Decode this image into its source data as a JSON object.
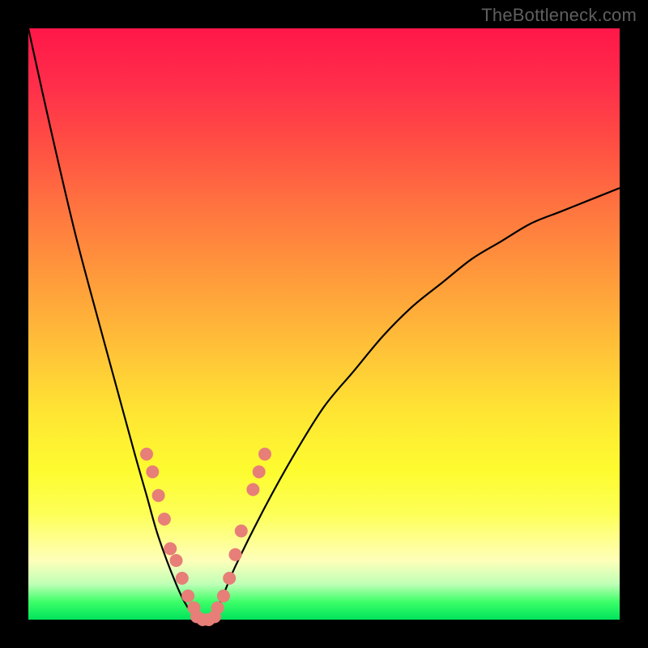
{
  "watermark": "TheBottleneck.com",
  "colors": {
    "frame": "#000000",
    "curve": "#000000",
    "beads": "#e77e78"
  },
  "chart_data": {
    "type": "line",
    "title": "",
    "xlabel": "",
    "ylabel": "",
    "ylim": [
      0,
      100
    ],
    "x": [
      0,
      4,
      8,
      12,
      15,
      18,
      20,
      22,
      25,
      27,
      29,
      30,
      32,
      35,
      40,
      45,
      50,
      55,
      60,
      65,
      70,
      75,
      80,
      85,
      90,
      95,
      100
    ],
    "series": [
      {
        "name": "bottleneck",
        "values": [
          100,
          82,
          65,
          50,
          39,
          28,
          21,
          14,
          6,
          2,
          0,
          0,
          2,
          9,
          19,
          28,
          36,
          42,
          48,
          53,
          57,
          61,
          64,
          67,
          69,
          71,
          73
        ]
      }
    ],
    "beads_left": [
      {
        "x": 20,
        "y": 28
      },
      {
        "x": 21,
        "y": 25
      },
      {
        "x": 22,
        "y": 21
      },
      {
        "x": 23,
        "y": 17
      },
      {
        "x": 24,
        "y": 12
      },
      {
        "x": 25,
        "y": 10
      },
      {
        "x": 26,
        "y": 7
      },
      {
        "x": 27,
        "y": 4
      },
      {
        "x": 28,
        "y": 2
      }
    ],
    "beads_right": [
      {
        "x": 32,
        "y": 2
      },
      {
        "x": 33,
        "y": 4
      },
      {
        "x": 34,
        "y": 7
      },
      {
        "x": 35,
        "y": 11
      },
      {
        "x": 36,
        "y": 15
      },
      {
        "x": 38,
        "y": 22
      },
      {
        "x": 39,
        "y": 25
      },
      {
        "x": 40,
        "y": 28
      }
    ],
    "beads_bottom": [
      {
        "x": 28.5,
        "y": 0.5
      },
      {
        "x": 29.5,
        "y": 0
      },
      {
        "x": 30.5,
        "y": 0
      },
      {
        "x": 31.5,
        "y": 0.5
      }
    ]
  }
}
